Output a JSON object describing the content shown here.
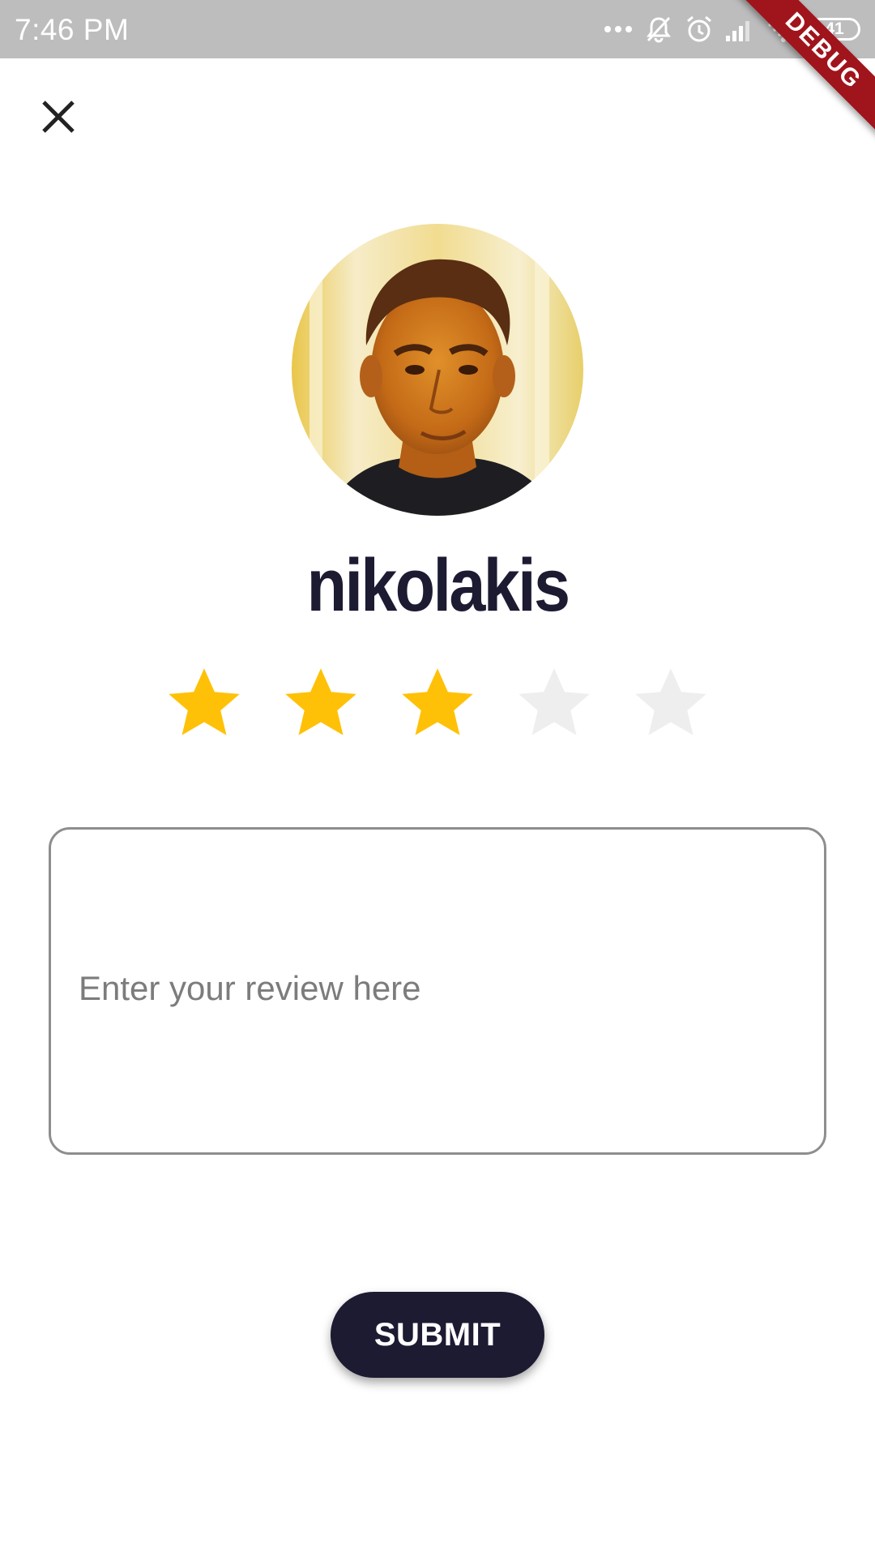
{
  "status_bar": {
    "time": "7:46 PM",
    "battery": "41",
    "icons": [
      "more-dots-icon",
      "bell-muted-icon",
      "alarm-icon",
      "signal-icon",
      "wifi-icon",
      "battery-icon"
    ]
  },
  "debug_banner": {
    "label": "DEBUG"
  },
  "header": {
    "close_icon": "close-icon"
  },
  "profile": {
    "name": "nikolakis"
  },
  "rating": {
    "value": 3,
    "max": 5,
    "filled_color": "#FFC107",
    "empty_color": "#EEEEEE"
  },
  "review": {
    "placeholder": "Enter your review here",
    "value": ""
  },
  "submit": {
    "label": "SUBMIT",
    "color": "#1C1B32"
  }
}
